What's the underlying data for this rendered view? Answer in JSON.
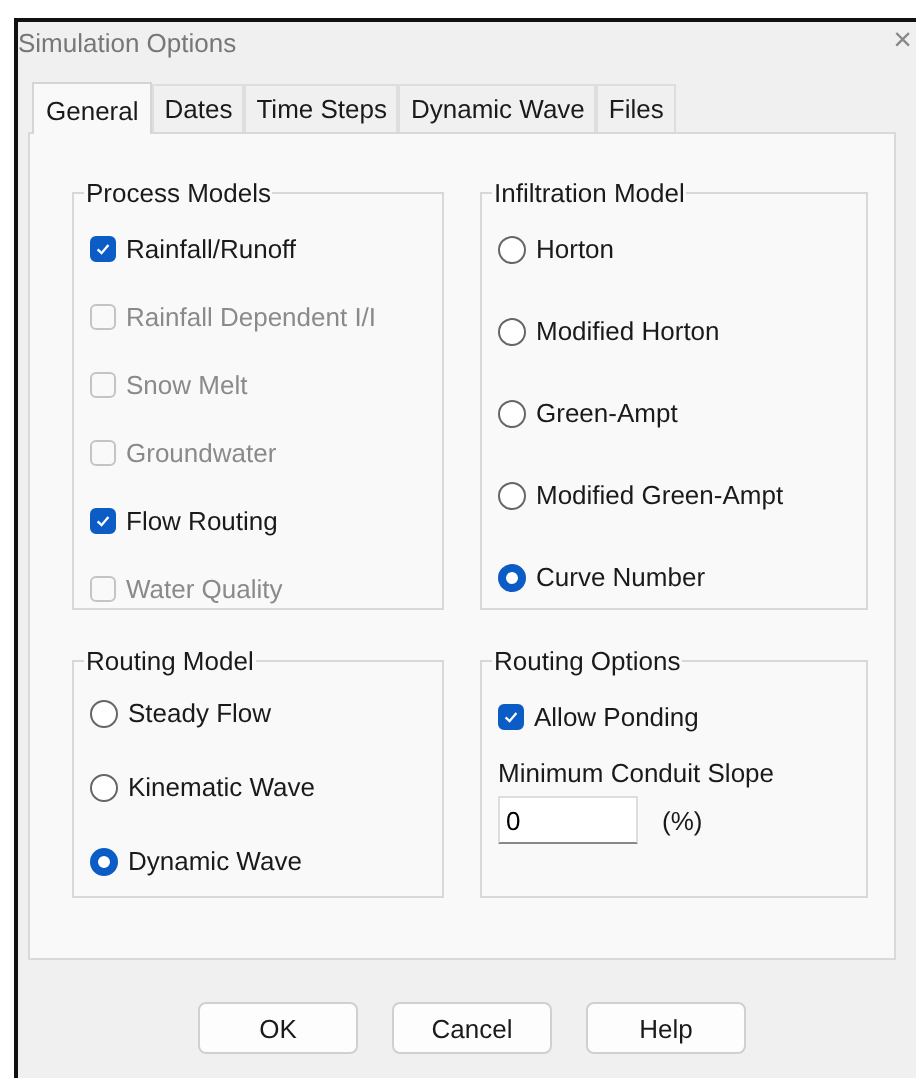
{
  "window": {
    "title": "Simulation Options",
    "close": "×"
  },
  "tabs": [
    {
      "label": "General",
      "selected": true
    },
    {
      "label": "Dates",
      "selected": false
    },
    {
      "label": "Time Steps",
      "selected": false
    },
    {
      "label": "Dynamic Wave",
      "selected": false
    },
    {
      "label": "Files",
      "selected": false
    }
  ],
  "process_models": {
    "title": "Process Models",
    "items": [
      {
        "label": "Rainfall/Runoff",
        "checked": true,
        "disabled": false
      },
      {
        "label": "Rainfall Dependent I/I",
        "checked": false,
        "disabled": true
      },
      {
        "label": "Snow Melt",
        "checked": false,
        "disabled": true
      },
      {
        "label": "Groundwater",
        "checked": false,
        "disabled": true
      },
      {
        "label": "Flow Routing",
        "checked": true,
        "disabled": false
      },
      {
        "label": "Water Quality",
        "checked": false,
        "disabled": true
      }
    ]
  },
  "infiltration_model": {
    "title": "Infiltration Model",
    "options": [
      {
        "label": "Horton",
        "selected": false
      },
      {
        "label": "Modified Horton",
        "selected": false
      },
      {
        "label": "Green-Ampt",
        "selected": false
      },
      {
        "label": "Modified Green-Ampt",
        "selected": false
      },
      {
        "label": "Curve Number",
        "selected": true
      }
    ]
  },
  "routing_model": {
    "title": "Routing Model",
    "options": [
      {
        "label": "Steady Flow",
        "selected": false
      },
      {
        "label": "Kinematic Wave",
        "selected": false
      },
      {
        "label": "Dynamic Wave",
        "selected": true
      }
    ]
  },
  "routing_options": {
    "title": "Routing Options",
    "allow_ponding": {
      "label": "Allow Ponding",
      "checked": true
    },
    "min_slope": {
      "label": "Minimum Conduit Slope",
      "value": "0",
      "unit": "(%)"
    }
  },
  "buttons": [
    "OK",
    "Cancel",
    "Help"
  ]
}
